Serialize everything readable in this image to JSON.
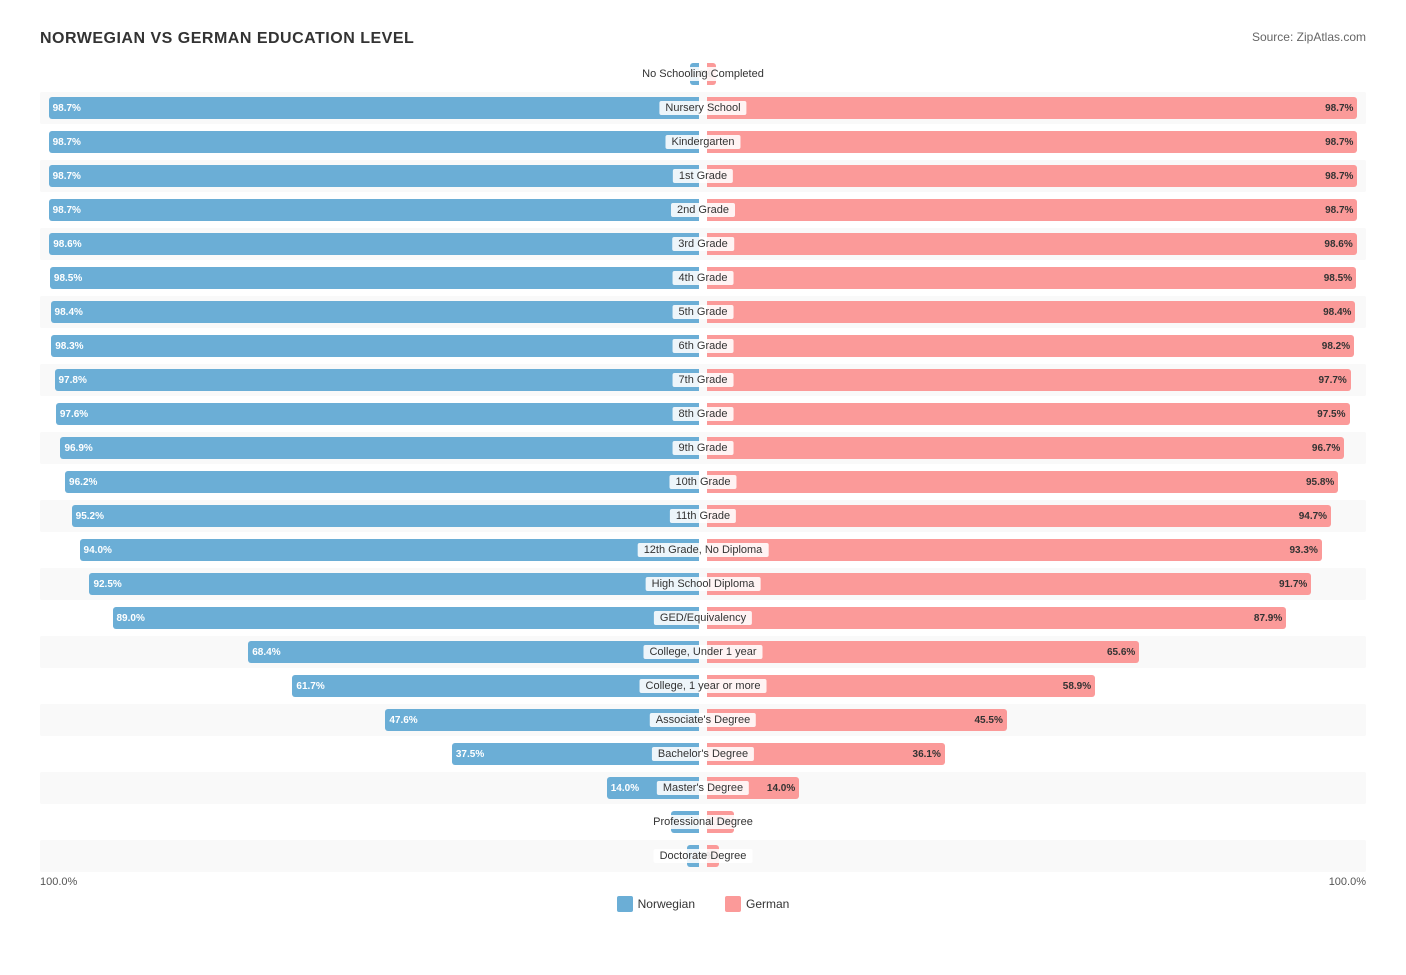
{
  "title": "NORWEGIAN VS GERMAN EDUCATION LEVEL",
  "source": "Source: ZipAtlas.com",
  "colors": {
    "norwegian": "#6baed6",
    "german": "#fb9a99"
  },
  "legend": {
    "norwegian_label": "Norwegian",
    "german_label": "German"
  },
  "bottom_labels": {
    "left": "100.0%",
    "right": "100.0%"
  },
  "rows": [
    {
      "label": "No Schooling Completed",
      "left_val": "1.3%",
      "right_val": "1.4%",
      "left_pct": 1.3,
      "right_pct": 1.4,
      "alt": false
    },
    {
      "label": "Nursery School",
      "left_val": "98.7%",
      "right_val": "98.7%",
      "left_pct": 98.7,
      "right_pct": 98.7,
      "alt": true
    },
    {
      "label": "Kindergarten",
      "left_val": "98.7%",
      "right_val": "98.7%",
      "left_pct": 98.7,
      "right_pct": 98.7,
      "alt": false
    },
    {
      "label": "1st Grade",
      "left_val": "98.7%",
      "right_val": "98.7%",
      "left_pct": 98.7,
      "right_pct": 98.7,
      "alt": true
    },
    {
      "label": "2nd Grade",
      "left_val": "98.7%",
      "right_val": "98.7%",
      "left_pct": 98.7,
      "right_pct": 98.7,
      "alt": false
    },
    {
      "label": "3rd Grade",
      "left_val": "98.6%",
      "right_val": "98.6%",
      "left_pct": 98.6,
      "right_pct": 98.6,
      "alt": true
    },
    {
      "label": "4th Grade",
      "left_val": "98.5%",
      "right_val": "98.5%",
      "left_pct": 98.5,
      "right_pct": 98.5,
      "alt": false
    },
    {
      "label": "5th Grade",
      "left_val": "98.4%",
      "right_val": "98.4%",
      "left_pct": 98.4,
      "right_pct": 98.4,
      "alt": true
    },
    {
      "label": "6th Grade",
      "left_val": "98.3%",
      "right_val": "98.2%",
      "left_pct": 98.3,
      "right_pct": 98.2,
      "alt": false
    },
    {
      "label": "7th Grade",
      "left_val": "97.8%",
      "right_val": "97.7%",
      "left_pct": 97.8,
      "right_pct": 97.7,
      "alt": true
    },
    {
      "label": "8th Grade",
      "left_val": "97.6%",
      "right_val": "97.5%",
      "left_pct": 97.6,
      "right_pct": 97.5,
      "alt": false
    },
    {
      "label": "9th Grade",
      "left_val": "96.9%",
      "right_val": "96.7%",
      "left_pct": 96.9,
      "right_pct": 96.7,
      "alt": true
    },
    {
      "label": "10th Grade",
      "left_val": "96.2%",
      "right_val": "95.8%",
      "left_pct": 96.2,
      "right_pct": 95.8,
      "alt": false
    },
    {
      "label": "11th Grade",
      "left_val": "95.2%",
      "right_val": "94.7%",
      "left_pct": 95.2,
      "right_pct": 94.7,
      "alt": true
    },
    {
      "label": "12th Grade, No Diploma",
      "left_val": "94.0%",
      "right_val": "93.3%",
      "left_pct": 94.0,
      "right_pct": 93.3,
      "alt": false
    },
    {
      "label": "High School Diploma",
      "left_val": "92.5%",
      "right_val": "91.7%",
      "left_pct": 92.5,
      "right_pct": 91.7,
      "alt": true
    },
    {
      "label": "GED/Equivalency",
      "left_val": "89.0%",
      "right_val": "87.9%",
      "left_pct": 89.0,
      "right_pct": 87.9,
      "alt": false
    },
    {
      "label": "College, Under 1 year",
      "left_val": "68.4%",
      "right_val": "65.6%",
      "left_pct": 68.4,
      "right_pct": 65.6,
      "alt": true
    },
    {
      "label": "College, 1 year or more",
      "left_val": "61.7%",
      "right_val": "58.9%",
      "left_pct": 61.7,
      "right_pct": 58.9,
      "alt": false
    },
    {
      "label": "Associate's Degree",
      "left_val": "47.6%",
      "right_val": "45.5%",
      "left_pct": 47.6,
      "right_pct": 45.5,
      "alt": true
    },
    {
      "label": "Bachelor's Degree",
      "left_val": "37.5%",
      "right_val": "36.1%",
      "left_pct": 37.5,
      "right_pct": 36.1,
      "alt": false
    },
    {
      "label": "Master's Degree",
      "left_val": "14.0%",
      "right_val": "14.0%",
      "left_pct": 14.0,
      "right_pct": 14.0,
      "alt": true
    },
    {
      "label": "Professional Degree",
      "left_val": "4.2%",
      "right_val": "4.1%",
      "left_pct": 4.2,
      "right_pct": 4.1,
      "alt": false
    },
    {
      "label": "Doctorate Degree",
      "left_val": "1.8%",
      "right_val": "1.8%",
      "left_pct": 1.8,
      "right_pct": 1.8,
      "alt": true
    }
  ]
}
